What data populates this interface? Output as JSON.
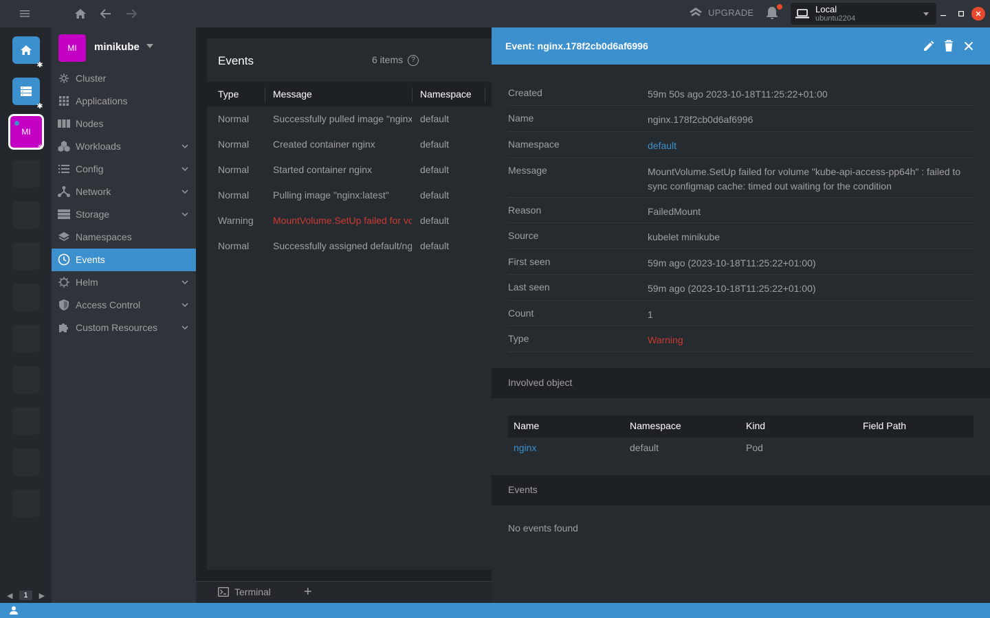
{
  "topbar": {
    "upgrade_label": "UPGRADE",
    "cluster_title": "Local",
    "cluster_subtitle": "ubuntu2204"
  },
  "hotbar": {
    "cluster_initials": "MI",
    "page_number": "1"
  },
  "sidebar": {
    "avatar_initials": "MI",
    "cluster_name": "minikube",
    "items": [
      {
        "label": "Cluster",
        "icon": "cluster-icon"
      },
      {
        "label": "Applications",
        "icon": "grid-icon"
      },
      {
        "label": "Nodes",
        "icon": "nodes-icon"
      },
      {
        "label": "Workloads",
        "icon": "workloads-icon"
      },
      {
        "label": "Config",
        "icon": "config-icon"
      },
      {
        "label": "Network",
        "icon": "network-icon"
      },
      {
        "label": "Storage",
        "icon": "storage-icon"
      },
      {
        "label": "Namespaces",
        "icon": "layers-icon"
      },
      {
        "label": "Events",
        "icon": "clock-icon"
      },
      {
        "label": "Helm",
        "icon": "helm-icon"
      },
      {
        "label": "Access Control",
        "icon": "shield-icon"
      },
      {
        "label": "Custom Resources",
        "icon": "puzzle-icon"
      }
    ]
  },
  "events_list": {
    "title": "Events",
    "count": "6 items",
    "help": "?",
    "columns": [
      "Type",
      "Message",
      "Namespace"
    ],
    "rows": [
      {
        "type": "Normal",
        "message": "Successfully pulled image \"nginx:latest\"",
        "namespace": "default"
      },
      {
        "type": "Normal",
        "message": "Created container nginx",
        "namespace": "default"
      },
      {
        "type": "Normal",
        "message": "Started container nginx",
        "namespace": "default"
      },
      {
        "type": "Normal",
        "message": "Pulling image \"nginx:latest\"",
        "namespace": "default"
      },
      {
        "type": "Warning",
        "message": "MountVolume.SetUp failed for volume",
        "namespace": "default"
      },
      {
        "type": "Normal",
        "message": "Successfully assigned default/nginx",
        "namespace": "default"
      }
    ]
  },
  "dock": {
    "terminal_label": "Terminal",
    "add_label": "+"
  },
  "details": {
    "title": "Event: nginx.178f2cb0d6af6996",
    "fields": [
      {
        "key": "Created",
        "value": "59m 50s ago 2023-10-18T11:25:22+01:00"
      },
      {
        "key": "Name",
        "value": "nginx.178f2cb0d6af6996"
      },
      {
        "key": "Namespace",
        "value": "default"
      },
      {
        "key": "Message",
        "value": "MountVolume.SetUp failed for volume \"kube-api-access-pp64h\" : failed to sync configmap cache: timed out waiting for the condition"
      },
      {
        "key": "Reason",
        "value": "FailedMount"
      },
      {
        "key": "Source",
        "value": "kubelet minikube"
      },
      {
        "key": "First seen",
        "value": "59m ago (2023-10-18T11:25:22+01:00)"
      },
      {
        "key": "Last seen",
        "value": "59m ago (2023-10-18T11:25:22+01:00)"
      },
      {
        "key": "Count",
        "value": "1"
      },
      {
        "key": "Type",
        "value": "Warning"
      }
    ],
    "involved_object": {
      "section_title": "Involved object",
      "columns": [
        "Name",
        "Namespace",
        "Kind",
        "Field Path"
      ],
      "row": {
        "name": "nginx",
        "namespace": "default",
        "kind": "Pod",
        "field_path": ""
      }
    },
    "events_section": {
      "title": "Events",
      "empty_text": "No events found"
    }
  },
  "colors": {
    "accent": "#3d90ce",
    "warning": "#ce3933",
    "cluster_badge": "#c400c4"
  }
}
